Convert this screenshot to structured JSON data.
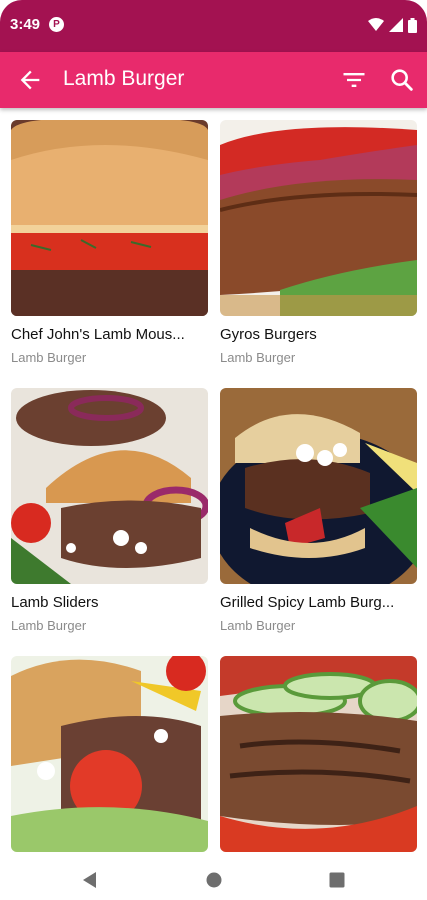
{
  "status_bar": {
    "time": "3:49",
    "app_icon": "app-notification-icon",
    "icons": [
      "wifi-icon",
      "signal-icon",
      "battery-icon"
    ]
  },
  "app_bar": {
    "title": "Lamb Burger",
    "icons": [
      "back-arrow-icon",
      "filter-icon",
      "search-icon"
    ],
    "color": "#e82a6c",
    "status_color": "#a31251"
  },
  "recipes": [
    {
      "name": "Chef John's Lamb Mous...",
      "category": "Lamb Burger"
    },
    {
      "name": "Gyros Burgers",
      "category": "Lamb Burger"
    },
    {
      "name": "Lamb Sliders",
      "category": "Lamb Burger"
    },
    {
      "name": "Grilled Spicy Lamb Burg...",
      "category": "Lamb Burger"
    },
    {
      "name": "",
      "category": ""
    },
    {
      "name": "",
      "category": ""
    }
  ],
  "nav_bar": {
    "icons": [
      "back-triangle-icon",
      "home-circle-icon",
      "recents-square-icon"
    ]
  }
}
